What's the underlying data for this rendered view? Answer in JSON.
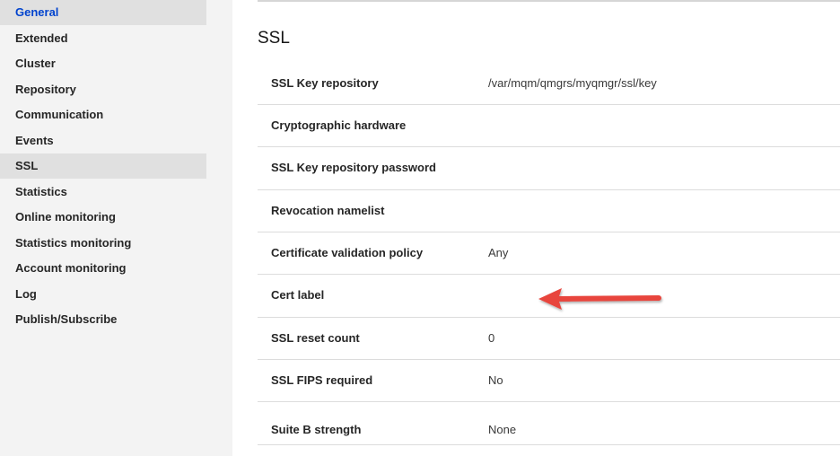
{
  "sidebar": {
    "items": [
      {
        "label": "General"
      },
      {
        "label": "Extended"
      },
      {
        "label": "Cluster"
      },
      {
        "label": "Repository"
      },
      {
        "label": "Communication"
      },
      {
        "label": "Events"
      },
      {
        "label": "SSL"
      },
      {
        "label": "Statistics"
      },
      {
        "label": "Online monitoring"
      },
      {
        "label": "Statistics monitoring"
      },
      {
        "label": "Account monitoring"
      },
      {
        "label": "Log"
      },
      {
        "label": "Publish/Subscribe"
      }
    ],
    "current": "General",
    "selected": "SSL"
  },
  "main": {
    "section_title": "SSL",
    "rows": [
      {
        "label": "SSL Key repository",
        "value": "/var/mqm/qmgrs/myqmgr/ssl/key"
      },
      {
        "label": "Cryptographic hardware",
        "value": ""
      },
      {
        "label": "SSL Key repository password",
        "value": ""
      },
      {
        "label": "Revocation namelist",
        "value": ""
      },
      {
        "label": "Certificate validation policy",
        "value": "Any"
      },
      {
        "label": "Cert label",
        "value": ""
      },
      {
        "label": "SSL reset count",
        "value": "0"
      },
      {
        "label": "SSL FIPS required",
        "value": "No"
      },
      {
        "label": "Suite B strength",
        "value": "None"
      }
    ]
  },
  "annotation": {
    "arrow_color": "#e8453c",
    "points_to": "Cert label"
  }
}
